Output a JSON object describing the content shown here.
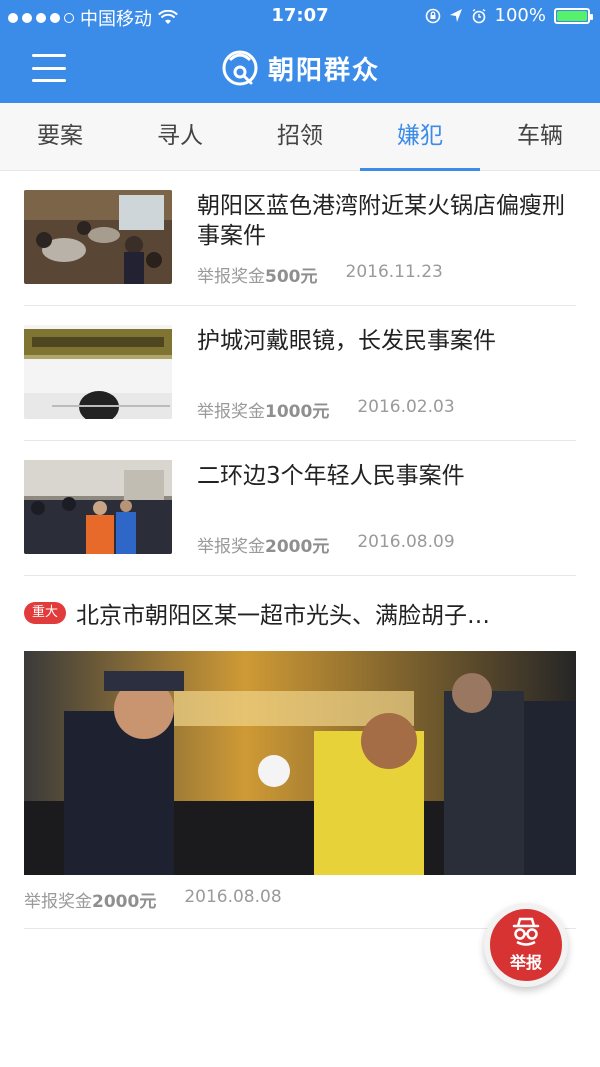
{
  "status_bar": {
    "carrier": "中国移动",
    "time": "17:07",
    "battery": "100%",
    "signal_bars_filled": 4,
    "signal_bars_total": 5
  },
  "header": {
    "title": "朝阳群众"
  },
  "tabs": [
    {
      "label": "要案",
      "active": false
    },
    {
      "label": "寻人",
      "active": false
    },
    {
      "label": "招领",
      "active": false
    },
    {
      "label": "嫌犯",
      "active": true
    },
    {
      "label": "车辆",
      "active": false
    }
  ],
  "items": [
    {
      "title": "朝阳区蓝色港湾附近某火锅店偏瘦刑事案件",
      "reward_label": "举报奖金",
      "reward_amount": "500元",
      "date": "2016.11.23"
    },
    {
      "title": "护城河戴眼镜，长发民事案件",
      "reward_label": "举报奖金",
      "reward_amount": "1000元",
      "date": "2016.02.03"
    },
    {
      "title": "二环边3个年轻人民事案件",
      "reward_label": "举报奖金",
      "reward_amount": "2000元",
      "date": "2016.08.09"
    }
  ],
  "featured": {
    "badge": "重大",
    "title": "北京市朝阳区某一超市光头、满脸胡子…",
    "reward_label": "举报奖金",
    "reward_amount": "2000元",
    "date": "2016.08.08"
  },
  "fab": {
    "label": "举报"
  },
  "colors": {
    "primary": "#3b8be9",
    "accent_red": "#d83333",
    "battery_fill": "#58f26a"
  }
}
